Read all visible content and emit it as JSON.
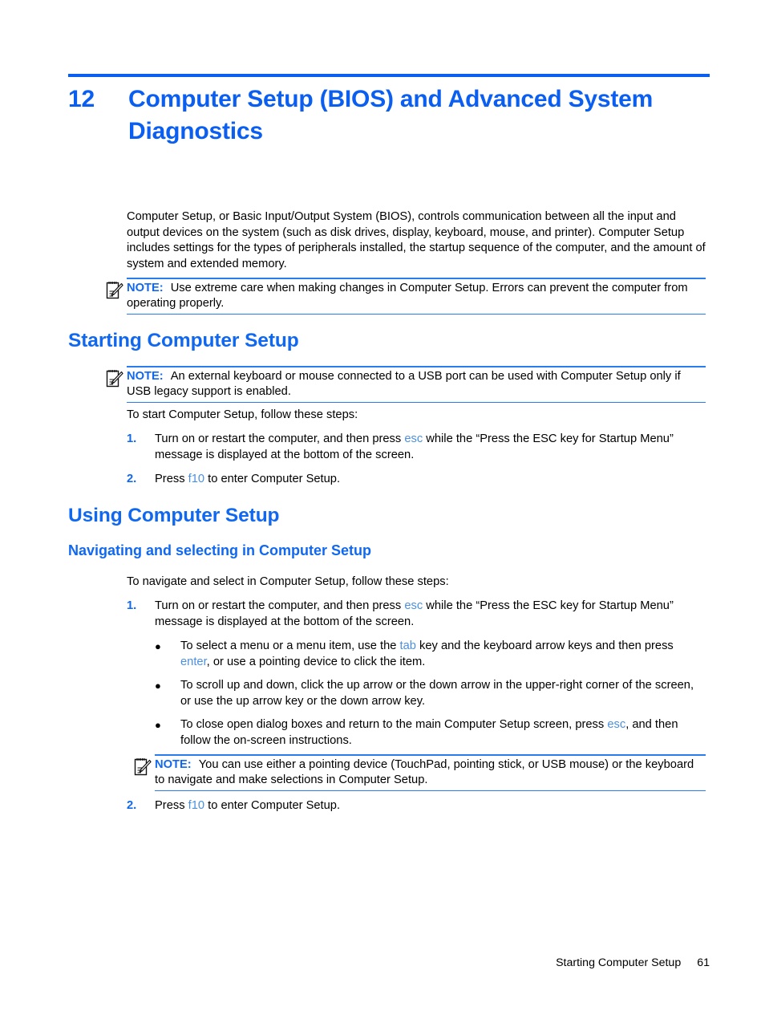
{
  "chapter": {
    "number": "12",
    "title": "Computer Setup (BIOS) and Advanced System Diagnostics"
  },
  "intro": {
    "paragraph": "Computer Setup, or Basic Input/Output System (BIOS), controls communication between all the input and output devices on the system (such as disk drives, display, keyboard, mouse, and printer). Computer Setup includes settings for the types of peripherals installed, the startup sequence of the computer, and the amount of system and extended memory."
  },
  "notes": {
    "label": "NOTE:",
    "icon": "note-pencil-icon",
    "intro_note": "Use extreme care when making changes in Computer Setup. Errors can prevent the computer from operating properly.",
    "starting_note": "An external keyboard or mouse connected to a USB port can be used with Computer Setup only if USB legacy support is enabled.",
    "navigating_note": "You can use either a pointing device (TouchPad, pointing stick, or USB mouse) or the keyboard to navigate and make selections in Computer Setup."
  },
  "sections": {
    "starting": {
      "heading": "Starting Computer Setup",
      "lead_in": "To start Computer Setup, follow these steps:",
      "steps": [
        {
          "number": "1.",
          "text_before": "Turn on or restart the computer, and then press ",
          "key": "esc",
          "text_after": " while the “Press the ESC key for Startup Menu” message is displayed at the bottom of the screen."
        },
        {
          "number": "2.",
          "text_before": "Press ",
          "key": "f10",
          "text_after": " to enter Computer Setup."
        }
      ]
    },
    "using": {
      "heading": "Using Computer Setup",
      "subheading": "Navigating and selecting in Computer Setup",
      "lead_in": "To navigate and select in Computer Setup, follow these steps:",
      "step1": {
        "number": "1.",
        "text_before": "Turn on or restart the computer, and then press ",
        "key": "esc",
        "text_after": " while the “Press the ESC key for Startup Menu” message is displayed at the bottom of the screen."
      },
      "bullets": [
        {
          "marker": "●",
          "text_before": "To select a menu or a menu item, use the ",
          "key": "tab",
          "text_mid": " key and the keyboard arrow keys and then press ",
          "key2": "enter",
          "text_after": ", or use a pointing device to click the item."
        },
        {
          "marker": "●",
          "text_before": "To scroll up and down, click the up arrow or the down arrow in the upper-right corner of the screen, or use the up arrow key or the down arrow key.",
          "key": "",
          "text_mid": "",
          "key2": "",
          "text_after": ""
        },
        {
          "marker": "●",
          "text_before": "To close open dialog boxes and return to the main Computer Setup screen, press ",
          "key": "esc",
          "text_mid": ", and then follow the on-screen instructions.",
          "key2": "",
          "text_after": ""
        }
      ],
      "step2": {
        "number": "2.",
        "text_before": "Press ",
        "key": "f10",
        "text_after": " to enter Computer Setup."
      }
    }
  },
  "footer": {
    "section_name": "Starting Computer Setup",
    "page_number": "61"
  },
  "colors": {
    "heading_blue": "#1068f0",
    "rule_blue": "#0a5ef0",
    "key_blue": "#4a90e2",
    "text_black": "#000000"
  }
}
